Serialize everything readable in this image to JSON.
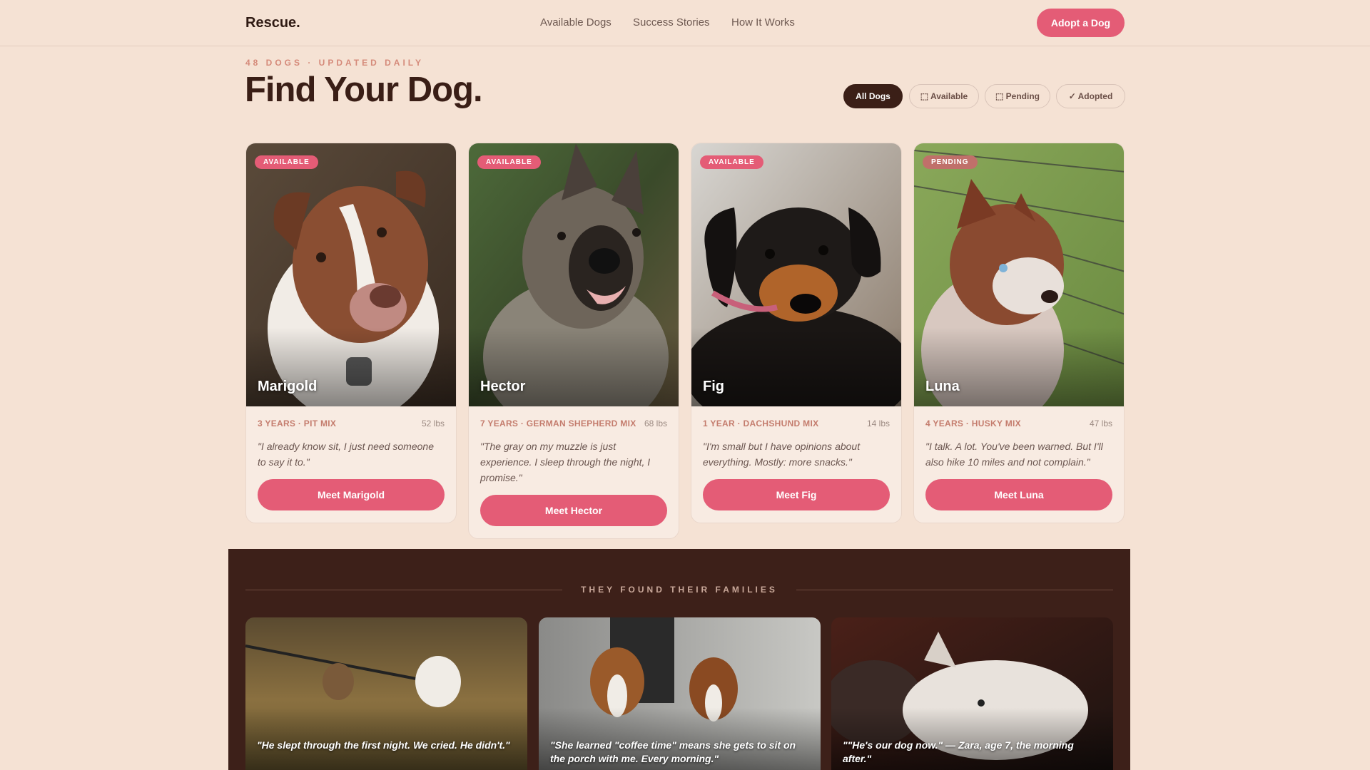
{
  "nav": {
    "brand": "Rescue.",
    "links": [
      "Available Dogs",
      "Success Stories",
      "How It Works"
    ],
    "cta": "Adopt a Dog"
  },
  "header": {
    "eyebrow": "48 DOGS · UPDATED DAILY",
    "title": "Find Your Dog."
  },
  "filters": [
    {
      "label": "All Dogs",
      "active": true
    },
    {
      "label": "⬚ Available",
      "active": false
    },
    {
      "label": "⬚ Pending",
      "active": false
    },
    {
      "label": "✓ Adopted",
      "active": false
    }
  ],
  "dogs": [
    {
      "name": "Marigold",
      "status": "AVAILABLE",
      "breed": "3 YEARS · PIT MIX",
      "weight": "52 lbs",
      "quote": "\"I already know sit, I just need someone to say it to.\"",
      "button": "Meet Marigold"
    },
    {
      "name": "Hector",
      "status": "AVAILABLE",
      "breed": "7 YEARS · GERMAN SHEPHERD MIX",
      "weight": "68 lbs",
      "quote": "\"The gray on my muzzle is just experience. I sleep through the night, I promise.\"",
      "button": "Meet Hector"
    },
    {
      "name": "Fig",
      "status": "AVAILABLE",
      "breed": "1 YEAR · DACHSHUND MIX",
      "weight": "14 lbs",
      "quote": "\"I'm small but I have opinions about everything. Mostly: more snacks.\"",
      "button": "Meet Fig"
    },
    {
      "name": "Luna",
      "status": "PENDING",
      "breed": "4 YEARS · HUSKY MIX",
      "weight": "47 lbs",
      "quote": "\"I talk. A lot. You've been warned. But I'll also hike 10 miles and not complain.\"",
      "button": "Meet Luna"
    }
  ],
  "stories": {
    "title": "THEY FOUND THEIR FAMILIES",
    "items": [
      {
        "quote": "\"He slept through the first night. We cried. He didn't.\""
      },
      {
        "quote": "\"She learned \"coffee time\" means she gets to sit on the porch with me. Every morning.\""
      },
      {
        "quote": "\"\"He's our dog now.\" — Zara, age 7, the morning after.\""
      }
    ]
  },
  "colors": {
    "background": "#f5e2d4",
    "accent": "#e45c76",
    "dark": "#3b1f17",
    "pending": "#c0706a"
  }
}
